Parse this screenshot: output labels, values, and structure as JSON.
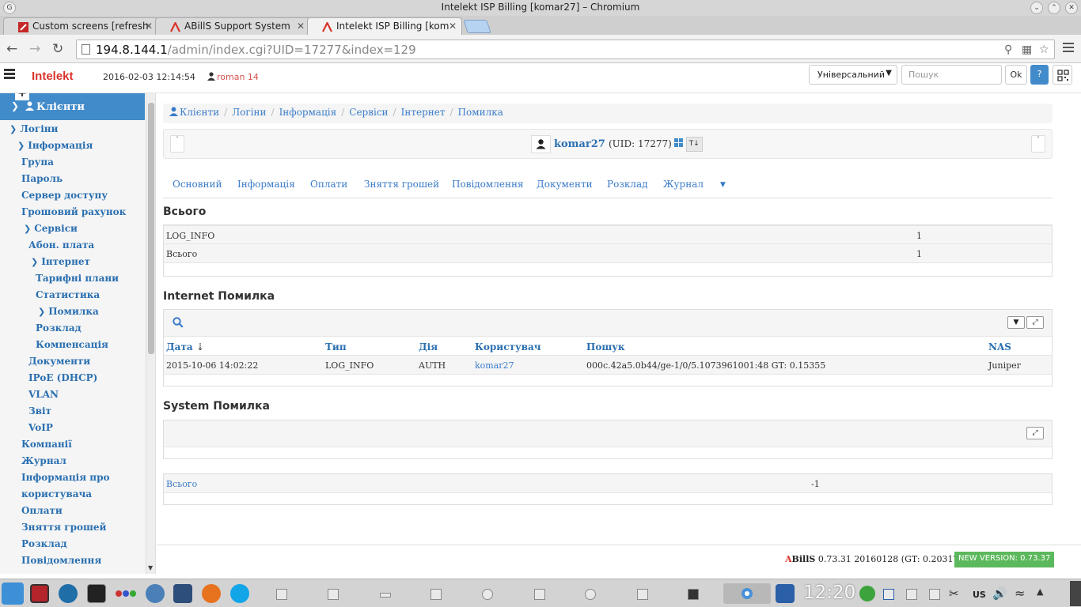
{
  "window": {
    "title": "Intelekt ISP Billing [komar27] – Chromium"
  },
  "browser": {
    "tabs": [
      {
        "label": "Custom screens [refresh"
      },
      {
        "label": "ABillS Support System"
      },
      {
        "label": "Intelekt ISP Billing [kom"
      }
    ],
    "url_host": "194.8.144.1",
    "url_path": "/admin/index.cgi?UID=17277&index=129"
  },
  "header": {
    "brand": "Intelekt",
    "datetime": "2016-02-03 12:14:54",
    "user": "roman 14",
    "search_type": "Універсальний",
    "search_placeholder": "Пошук",
    "ok_label": "Ok",
    "help_label": "?"
  },
  "sidebar": {
    "head": "Клієнти",
    "plus": "+",
    "items": [
      {
        "label": "Логіни",
        "chevron": true
      },
      {
        "label": "Інформація",
        "chevron": true
      },
      {
        "label": "Група"
      },
      {
        "label": "Пароль"
      },
      {
        "label": "Сервер доступу"
      },
      {
        "label": "Грошовий рахунок"
      },
      {
        "label": "Сервіси",
        "chevron": true
      },
      {
        "label": "Абон. плата"
      },
      {
        "label": "Інтернет",
        "chevron": true
      },
      {
        "label": "Тарифні плани"
      },
      {
        "label": "Статистика"
      },
      {
        "label": "Помилка",
        "chevron": true
      },
      {
        "label": "Розклад"
      },
      {
        "label": "Компенсація"
      },
      {
        "label": "Документи"
      },
      {
        "label": "IPoE (DHCP)"
      },
      {
        "label": "VLAN"
      },
      {
        "label": "Звіт"
      },
      {
        "label": "VoIP"
      },
      {
        "label": "Компанії"
      },
      {
        "label": "Журнал"
      },
      {
        "label": "Інформація про"
      },
      {
        "label": "користувача"
      },
      {
        "label": "Оплати"
      },
      {
        "label": "Зняття грошей"
      },
      {
        "label": "Розклад"
      },
      {
        "label": "Повідомлення"
      }
    ]
  },
  "breadcrumb": [
    "Клієнти",
    "Логіни",
    "Інформація",
    "Сервіси",
    "Інтернет",
    "Помилка"
  ],
  "user_panel": {
    "login": "komar27",
    "uid": "(UID: 17277)",
    "t_label": "Т↓"
  },
  "nav_tabs": [
    "Основний",
    "Інформація",
    "Оплати",
    "Зняття грошей",
    "Повідомлення",
    "Документи",
    "Розклад",
    "Журнал"
  ],
  "totals": {
    "title": "Всього",
    "rows": [
      {
        "name": "LOG_INFO",
        "value": "1"
      },
      {
        "name": "Всього",
        "value": "1"
      }
    ]
  },
  "internet_errors": {
    "title": "Internet Помилка",
    "columns": [
      "Дата",
      "Тип",
      "Дія",
      "Користувач",
      "Пошук",
      "NAS"
    ],
    "sort_indicator": "⇣",
    "rows": [
      {
        "date": "2015-10-06 14:02:22",
        "type": "LOG_INFO",
        "action": "AUTH",
        "user": "komar27",
        "search": "000c.42a5.0b44/ge-1/0/5.1073961001:48 GT: 0.15355",
        "nas": "Juniper"
      }
    ]
  },
  "system_errors": {
    "title": "System Помилка"
  },
  "summary": {
    "label": "Всього",
    "value": "-1"
  },
  "footer": {
    "brand_a": "A",
    "brand_b": "BillS",
    "version": " 0.73.31 20160128 (GT: 0.20317)",
    "new_version": "NEW VERSION: 0.73.37"
  },
  "taskbar": {
    "clock": "12:20",
    "keyboard": "US"
  },
  "colors": {
    "accent": "#428bca",
    "brand": "#d9342b",
    "link": "#3a7bc8",
    "success": "#5cb85c"
  }
}
